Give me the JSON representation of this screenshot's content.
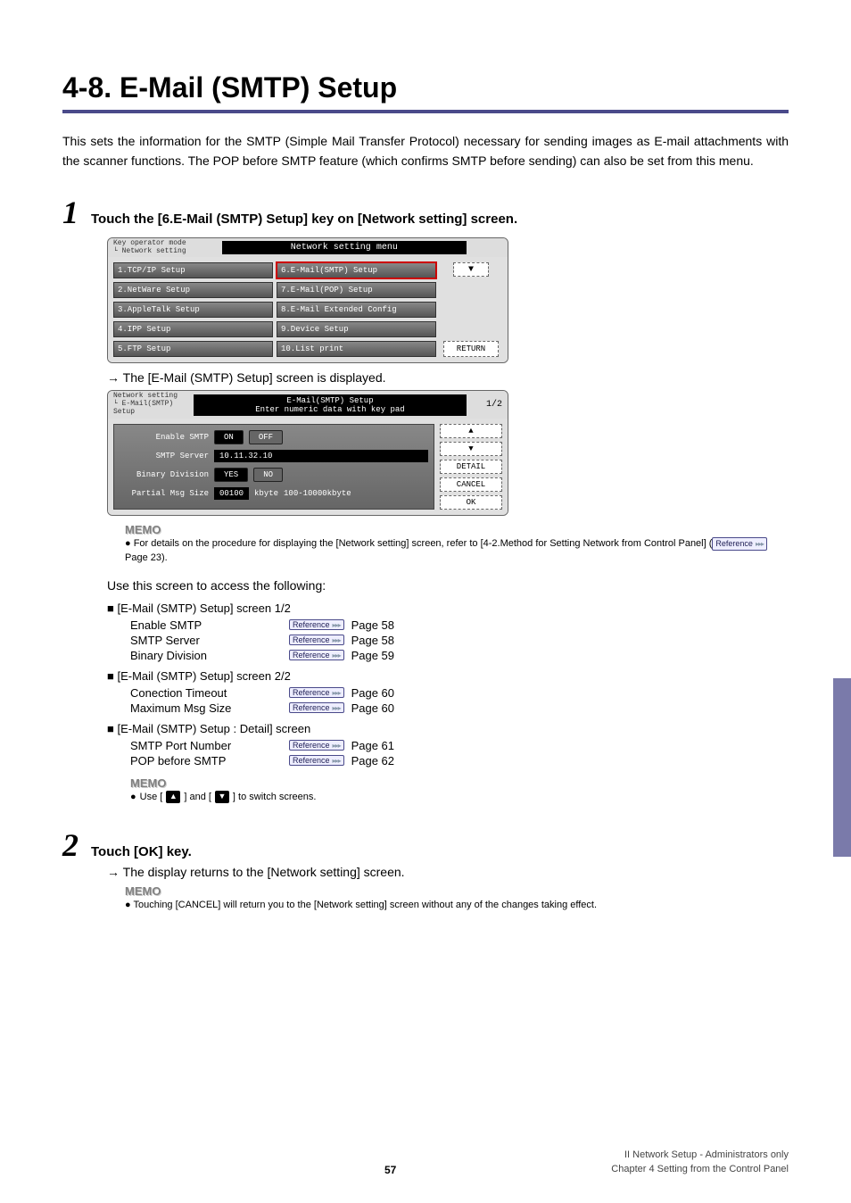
{
  "title": "4-8. E-Mail (SMTP) Setup",
  "intro": "This sets the information for the SMTP (Simple Mail Transfer Protocol) necessary for sending images as E-mail attachments with the scanner functions. The POP before SMTP feature (which confirms SMTP before sending) can also be set from this menu.",
  "step1": {
    "num": "1",
    "text": "Touch the [6.E-Mail (SMTP) Setup] key on [Network setting] screen."
  },
  "panel1": {
    "header_left_line1": "Key operator mode",
    "header_left_line2": "└ Network setting",
    "header_center": "Network setting menu",
    "left_items": [
      "1.TCP/IP Setup",
      "2.NetWare Setup",
      "3.AppleTalk Setup",
      "4.IPP Setup",
      "5.FTP Setup"
    ],
    "right_items": [
      "6.E-Mail(SMTP) Setup",
      "7.E-Mail(POP) Setup",
      "8.E-Mail Extended Config",
      "9.Device Setup",
      "10.List print"
    ],
    "return_btn": "RETURN"
  },
  "arrow_line1": "→ The [E-Mail (SMTP) Setup] screen is displayed.",
  "panel2": {
    "header_left_line1": "Network setting",
    "header_left_line2": "└ E-Mail(SMTP) Setup",
    "header_mid_line1": "E-Mail(SMTP) Setup",
    "header_mid_line2": "Enter numeric data with key pad",
    "header_right": "1/2",
    "row1_label": "Enable SMTP",
    "row1_on": "ON",
    "row1_off": "OFF",
    "row2_label": "SMTP Server",
    "row2_val": "10.11.32.10",
    "row3_label": "Binary Division",
    "row3_yes": "YES",
    "row3_no": "NO",
    "row4_label": "Partial Msg Size",
    "row4_val": "00100",
    "row4_unit": "kbyte",
    "row4_range": "100-10000kbyte",
    "side": {
      "detail": "DETAIL",
      "cancel": "CANCEL",
      "ok": "OK"
    }
  },
  "memo1": {
    "label": "MEMO",
    "body_prefix": "For details on the procedure for displaying the [Network setting] screen, refer to [4-2.Method for Setting Network from Control Panel] (",
    "body_suffix": " Page 23)."
  },
  "subintro": "Use this screen to access the following:",
  "lists": {
    "g1_title": "[E-Mail (SMTP) Setup] screen 1/2",
    "g1_items": [
      {
        "name": "Enable SMTP",
        "page": "Page 58"
      },
      {
        "name": "SMTP Server",
        "page": "Page 58"
      },
      {
        "name": "Binary Division",
        "page": "Page 59"
      }
    ],
    "g2_title": "[E-Mail (SMTP) Setup] screen 2/2",
    "g2_items": [
      {
        "name": "Conection Timeout",
        "page": "Page 60"
      },
      {
        "name": "Maximum Msg Size",
        "page": "Page 60"
      }
    ],
    "g3_title": "[E-Mail (SMTP) Setup : Detail] screen",
    "g3_items": [
      {
        "name": "SMTP Port Number",
        "page": "Page 61"
      },
      {
        "name": "POP before SMTP",
        "page": "Page 62"
      }
    ]
  },
  "memo2": {
    "label": "MEMO",
    "prefix": "Use [",
    "mid": "] and [",
    "suffix": "] to switch screens."
  },
  "step2": {
    "num": "2",
    "text": "Touch [OK] key.",
    "arrow": "→ The display returns to the [Network setting] screen."
  },
  "memo3": {
    "label": "MEMO",
    "body": "Touching [CANCEL] will return you to the [Network setting] screen without any of the changes taking effect."
  },
  "reference_label": "Reference",
  "footer": {
    "page": "57",
    "right1": "II Network Setup - Administrators only",
    "right2": "Chapter 4 Setting from the Control Panel"
  }
}
